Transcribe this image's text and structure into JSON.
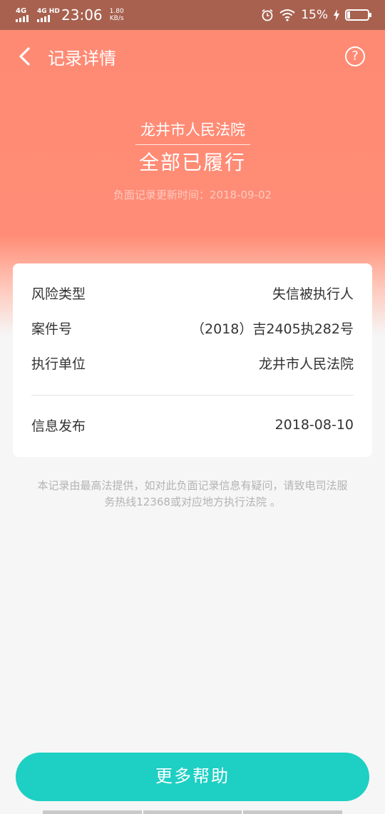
{
  "status_bar": {
    "sim1": "4G",
    "sim2": "4G HD",
    "time": "23:06",
    "speed_value": "1.80",
    "speed_unit": "KB/s",
    "battery": "15%",
    "battery_level": 0.15,
    "icons": [
      "signal-icon",
      "alarm-icon",
      "wifi-icon",
      "charging-icon",
      "battery-icon"
    ]
  },
  "toolbar": {
    "title": "记录详情",
    "back_icon": "back-arrow-icon",
    "help_icon": "question-icon",
    "help_symbol": "?"
  },
  "header": {
    "court": "龙井市人民法院",
    "status": "全部已履行",
    "update_label": "负面记录更新时间：",
    "update_date": "2018-09-02"
  },
  "details": {
    "rows": [
      {
        "label": "风险类型",
        "value": "失信被执行人"
      },
      {
        "label": "案件号",
        "value": "（2018）吉2405执282号"
      },
      {
        "label": "执行单位",
        "value": "龙井市人民法院"
      }
    ],
    "publish": {
      "label": "信息发布",
      "value": "2018-08-10"
    }
  },
  "note": "本记录由最高法提供，如对此负面记录信息有疑问，请致电司法服务热线12368或对应地方执行法院 。",
  "button": {
    "label": "更多帮助"
  },
  "colors": {
    "header": "#ff8c76",
    "status_bar": "#a8614f",
    "button": "#1ecfc3",
    "background": "#f6f6f6"
  }
}
